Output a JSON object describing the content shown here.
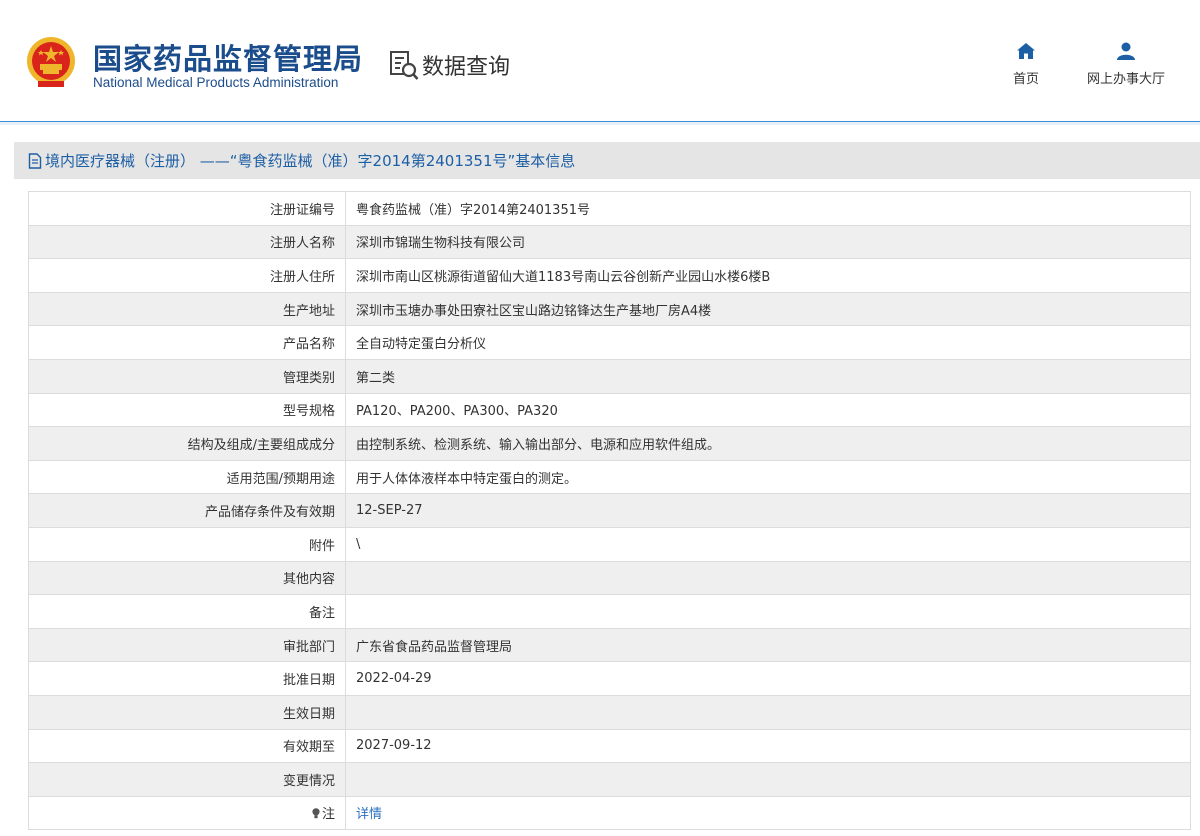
{
  "header": {
    "logo_cn": "国家药品监督管理局",
    "logo_en": "National Medical Products Administration",
    "query_title": "数据查询",
    "nav": [
      {
        "label": "首页",
        "icon": "home-icon"
      },
      {
        "label": "网上办事大厅",
        "icon": "user-icon"
      }
    ],
    "colors": {
      "brand": "#1b4c8c",
      "accent": "#3f8fd2",
      "emblem_red": "#d9241c",
      "emblem_gold": "#f0b62b"
    }
  },
  "title_bar": {
    "text": "境内医疗器械（注册） ——“粤食药监械（准）字2014第2401351号”基本信息",
    "icon": "document-icon"
  },
  "rows": [
    {
      "label": "注册证编号",
      "value": "粤食药监械（准）字2014第2401351号"
    },
    {
      "label": "注册人名称",
      "value": "深圳市锦瑞生物科技有限公司"
    },
    {
      "label": "注册人住所",
      "value": "深圳市南山区桃源街道留仙大道1183号南山云谷创新产业园山水楼6楼B"
    },
    {
      "label": "生产地址",
      "value": "深圳市玉塘办事处田寮社区宝山路边铭锋达生产基地厂房A4楼"
    },
    {
      "label": "产品名称",
      "value": "全自动特定蛋白分析仪"
    },
    {
      "label": "管理类别",
      "value": "第二类"
    },
    {
      "label": "型号规格",
      "value": "PA120、PA200、PA300、PA320"
    },
    {
      "label": "结构及组成/主要组成成分",
      "value": "由控制系统、检测系统、输入输出部分、电源和应用软件组成。"
    },
    {
      "label": "适用范围/预期用途",
      "value": "用于人体体液样本中特定蛋白的测定。"
    },
    {
      "label": "产品储存条件及有效期",
      "value": "12-SEP-27"
    },
    {
      "label": "附件",
      "value": "\\"
    },
    {
      "label": "其他内容",
      "value": ""
    },
    {
      "label": "备注",
      "value": ""
    },
    {
      "label": "审批部门",
      "value": "广东省食品药品监督管理局"
    },
    {
      "label": "批准日期",
      "value": "2022-04-29"
    },
    {
      "label": "生效日期",
      "value": ""
    },
    {
      "label": "有效期至",
      "value": "2027-09-12"
    },
    {
      "label": "变更情况",
      "value": ""
    },
    {
      "label": "注",
      "value": "详情",
      "label_icon": "lightbulb-icon"
    }
  ]
}
